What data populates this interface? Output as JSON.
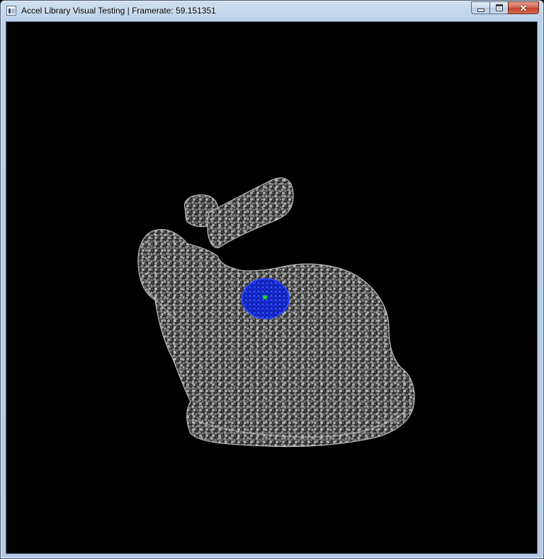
{
  "window": {
    "title": "Accel Library Visual Testing | Framerate: 59.151351",
    "controls": {
      "minimize": "minimize",
      "maximize": "maximize",
      "close": "close"
    }
  },
  "viewport": {
    "background": "#000000",
    "model_color": "#9a9a9a",
    "selection_color": "#1a2fe0",
    "query_point_color": "#19e019"
  }
}
